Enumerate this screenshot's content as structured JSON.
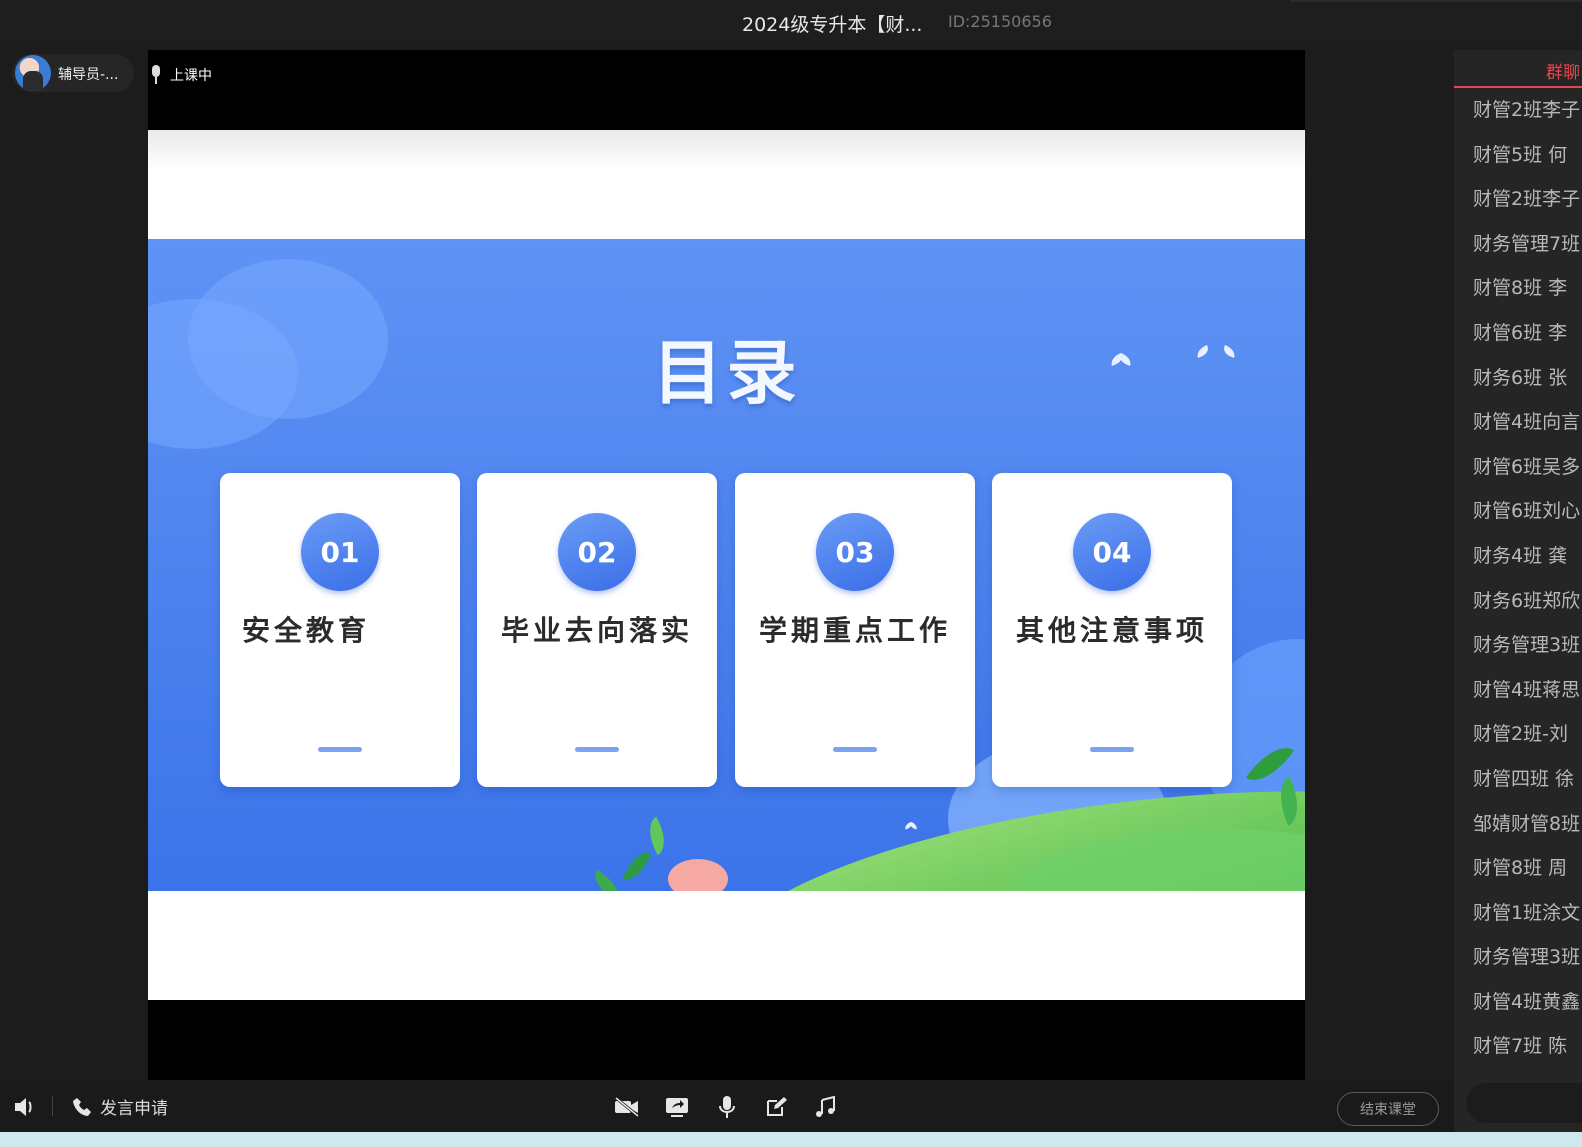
{
  "window": {
    "title": "2024级专升本【财...",
    "room_id": "ID:25150656"
  },
  "teacher": {
    "name": "辅导员-..."
  },
  "stage": {
    "status": "上课中"
  },
  "slide": {
    "title": "目录",
    "cards": [
      {
        "num": "01",
        "label": "安全教育"
      },
      {
        "num": "02",
        "label": "毕业去向落实"
      },
      {
        "num": "03",
        "label": "学期重点工作"
      },
      {
        "num": "04",
        "label": "其他注意事项"
      }
    ],
    "colors": {
      "blue_top": "#5f93f5",
      "blue_bottom": "#3b73e9",
      "badge": "#4a80ee",
      "grass": "#5fc85a"
    }
  },
  "sidebar": {
    "tab_label": "群聊",
    "members": [
      "财管2班李子",
      "财管5班 何",
      "财管2班李子",
      "财务管理7班",
      "财管8班 李",
      "财管6班 李",
      "财务6班 张",
      "财管4班向言",
      "财管6班吴多",
      "财管6班刘心",
      "财务4班 龚",
      "财务6班郑欣",
      "财务管理3班",
      "财管4班蒋思",
      "财管2班-刘",
      "财管四班 徐",
      "邹婧财管8班",
      "财管8班 周",
      "财管1班涂文",
      "财务管理3班",
      "财管4班黄鑫",
      "财管7班 陈"
    ]
  },
  "bottombar": {
    "speak_request": "发言申请",
    "end_class": "结束课堂",
    "icons": [
      "speaker-icon",
      "phone-icon",
      "camera-off-icon",
      "screen-share-icon",
      "microphone-icon",
      "edit-icon",
      "music-icon"
    ]
  }
}
